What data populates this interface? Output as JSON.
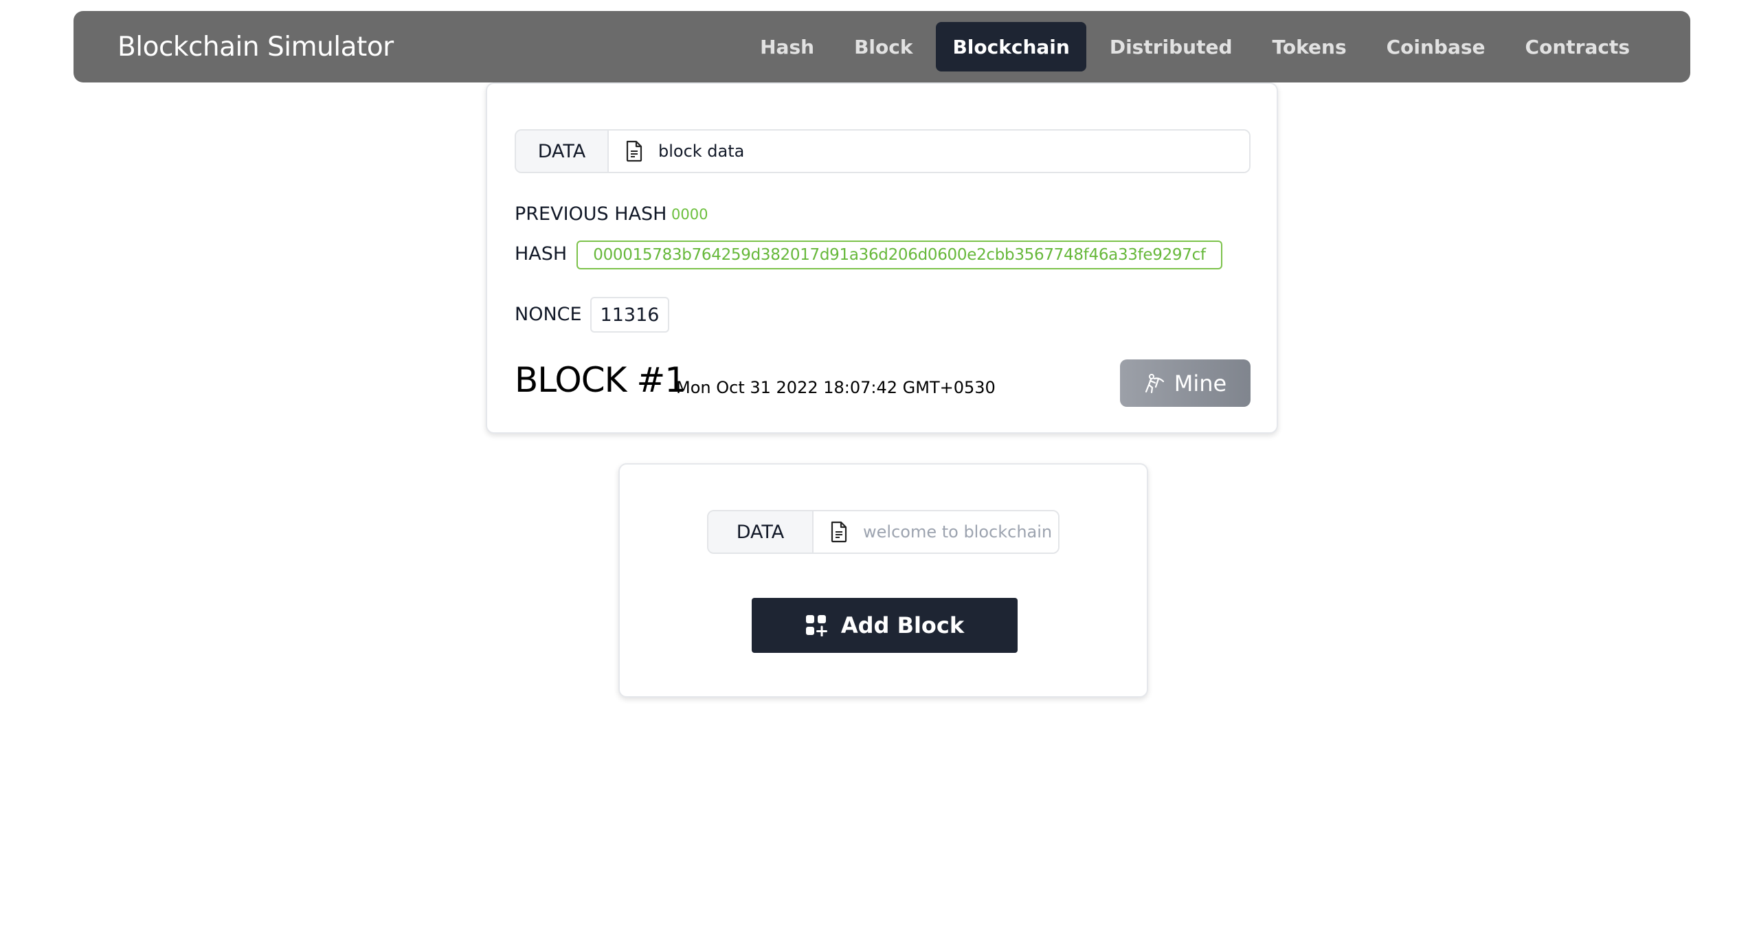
{
  "navbar": {
    "brand": "Blockchain Simulator",
    "items": [
      {
        "label": "Hash",
        "active": false
      },
      {
        "label": "Block",
        "active": false
      },
      {
        "label": "Blockchain",
        "active": true
      },
      {
        "label": "Distributed",
        "active": false
      },
      {
        "label": "Tokens",
        "active": false
      },
      {
        "label": "Coinbase",
        "active": false
      },
      {
        "label": "Contracts",
        "active": false
      }
    ]
  },
  "block": {
    "data_label": "DATA",
    "data_value": "block data",
    "data_icon": "document-icon",
    "previous_hash_label": "PREVIOUS HASH",
    "previous_hash": "0000",
    "hash_label": "HASH",
    "hash": "000015783b764259d382017d91a36d206d0600e2cbb3567748f46a33fe9297cf",
    "nonce_label": "NONCE",
    "nonce": "11316",
    "title": "BLOCK #1",
    "timestamp": "Mon Oct 31 2022 18:07:42 GMT+0530",
    "mine_label": "Mine",
    "mine_icon": "pickaxe-icon",
    "valid_color": "#66b83a"
  },
  "add_block": {
    "data_label": "DATA",
    "placeholder": "welcome to blockchain demo",
    "data_icon": "document-icon",
    "button_label": "Add Block",
    "button_icon": "grid-plus-icon"
  }
}
